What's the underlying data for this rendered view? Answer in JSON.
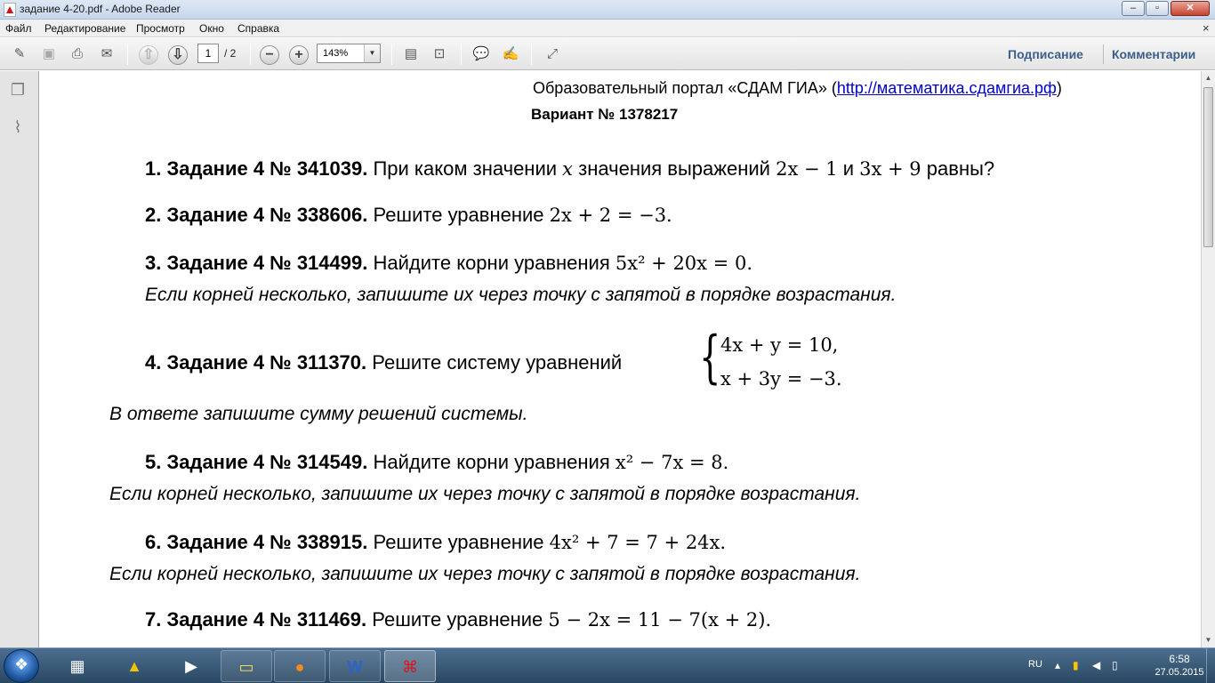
{
  "window": {
    "title": "задание 4-20.pdf - Adobe Reader",
    "minimize": "–",
    "maximize": "▫",
    "close": "✕"
  },
  "menu": {
    "items": [
      "Файл",
      "Редактирование",
      "Просмотр",
      "Окно",
      "Справка"
    ],
    "close_glyph": "×"
  },
  "toolbar": {
    "icons": [
      "edit-icon",
      "save-icon",
      "print-icon",
      "email-icon",
      "prev-page-icon",
      "next-page-icon",
      "zoom-out-icon",
      "zoom-in-icon",
      "fit-page-icon",
      "fit-width-icon",
      "comment-icon",
      "highlight-icon",
      "fullscreen-icon"
    ],
    "page_current": "1",
    "page_total": "/ 2",
    "zoom": "143%",
    "sign_label": "Подписание",
    "comments_label": "Комментарии"
  },
  "navpane": {
    "icons": [
      "pages-icon",
      "attachments-icon"
    ]
  },
  "document": {
    "portal_text": "Образовательный портал «СДАМ ГИА» (",
    "portal_link": "http://математика.сдамгиа.рф",
    "portal_close": ")",
    "variant": "Вариант № 1378217",
    "tasks": [
      {
        "label": "1. Задание 4 № 341039.",
        "text": "При каком значении",
        "var": "x",
        "text2": "значения выражений",
        "expr1": "2x − 1",
        "and": "и",
        "expr2": "3x + 9",
        "text3": "равны?"
      },
      {
        "label": "2. Задание 4 № 338606.",
        "text": "Решите уравнение",
        "expr": "2x + 2 = −3."
      },
      {
        "label": "3. Задание 4 № 314499.",
        "text": "Найдите корни уравнения",
        "expr": "5x² + 20x = 0.",
        "note": "Если корней несколько, запишите их через точку с запятой в порядке возрастания."
      },
      {
        "label": "4. Задание 4 № 311370.",
        "text": "Решите систему уравнений",
        "eq1": "4x + y = 10,",
        "eq2": "x + 3y = −3.",
        "note": "В ответе запишите сумму решений системы."
      },
      {
        "label": "5. Задание 4 № 314549.",
        "text": "Найдите корни уравнения",
        "expr": "x² − 7x = 8.",
        "note": "Если корней несколько, запишите их через точку с запятой в порядке возрастания."
      },
      {
        "label": "6. Задание 4 № 338915.",
        "text": "Решите уравнение",
        "expr": "4x² + 7 = 7 + 24x.",
        "note": "Если корней несколько, запишите их через точку с запятой в порядке возрастания."
      },
      {
        "label": "7. Задание 4 № 311469.",
        "text": "Решите уравнение",
        "expr": "5 − 2x = 11 − 7(x + 2)."
      }
    ]
  },
  "taskbar": {
    "apps": [
      "calculator-icon",
      "aimp-icon",
      "media-player-classic-icon",
      "explorer-icon",
      "firefox-icon",
      "word-icon",
      "adobe-reader-icon"
    ],
    "lang": "RU",
    "time": "6:58",
    "date": "27.05.2015"
  }
}
